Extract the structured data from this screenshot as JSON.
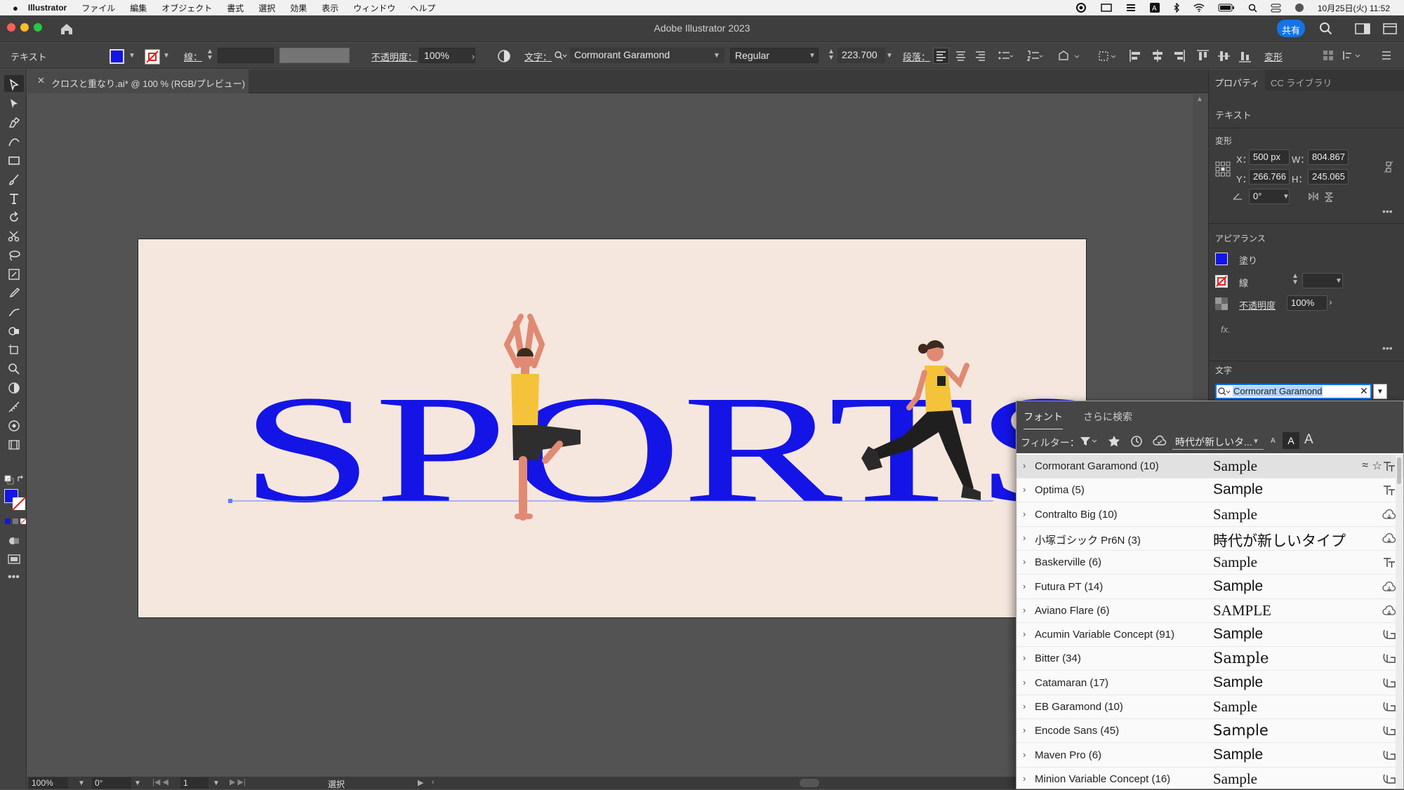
{
  "menubar": {
    "app": "Illustrator",
    "items": [
      "ファイル",
      "編集",
      "オブジェクト",
      "書式",
      "選択",
      "効果",
      "表示",
      "ウィンドウ",
      "ヘルプ"
    ],
    "datetime": "10月25日(火) 11:52"
  },
  "titlebar": {
    "title": "Adobe Illustrator 2023",
    "share_label": "共有"
  },
  "control": {
    "mode": "テキスト",
    "stroke_label": "線：",
    "opacity_label": "不透明度：",
    "opacity_value": "100%",
    "char_label": "文字：",
    "font_value": "Cormorant Garamond",
    "style_value": "Regular",
    "size_value": "223.700",
    "para_label": "段落：",
    "transform_label": "変形"
  },
  "doc": {
    "tab_title": "クロスと重なり.ai* @ 100 % (RGB/プレビュー)"
  },
  "artwork": {
    "text": "SPORTS",
    "text_color": "#1414e6",
    "bg_color": "#f5e7de"
  },
  "status": {
    "zoom": "100%",
    "rotation": "0°",
    "artboard_num": "1",
    "tool": "選択"
  },
  "properties": {
    "tab_properties": "プロパティ",
    "tab_cc": "CC ライブラリ",
    "type_heading": "テキスト",
    "transform_heading": "変形",
    "x_label": "X：",
    "x_value": "500 px",
    "y_label": "Y：",
    "y_value": "266.766",
    "w_label": "W：",
    "w_value": "804.867",
    "h_label": "H：",
    "h_value": "245.065",
    "angle_value": "0°",
    "appearance_heading": "アピアランス",
    "fill_label": "塗り",
    "stroke_label": "線",
    "opacity_label": "不透明度",
    "opacity_value": "100%",
    "fx_label": "fx.",
    "char_heading": "文字",
    "font_search_value": "Cormorant Garamond"
  },
  "font_popup": {
    "tab_fonts": "フォント",
    "tab_more": "さらに検索",
    "filter_label": "フィルター：",
    "sample_text_select": "時代が新しいタ...",
    "fonts": [
      {
        "name": "Cormorant Garamond (10)",
        "sample": "Sample",
        "icon": "tt-icon",
        "selected": true
      },
      {
        "name": "Optima (5)",
        "sample": "Sample",
        "icon": "tt-icon"
      },
      {
        "name": "Contralto Big (10)",
        "sample": "Sample",
        "icon": "cloud-activate-icon"
      },
      {
        "name": "小塚ゴシック Pr6N (3)",
        "sample": "時代が新しいタイプ",
        "icon": "cloud-activate-icon"
      },
      {
        "name": "Baskerville (6)",
        "sample": "Sample",
        "icon": "tt-icon"
      },
      {
        "name": "Futura PT (14)",
        "sample": "Sample",
        "icon": "cloud-activate-icon"
      },
      {
        "name": "Aviano Flare (6)",
        "sample": "SAMPLE",
        "icon": "cloud-activate-icon"
      },
      {
        "name": "Acumin Variable Concept (91)",
        "sample": "Sample",
        "icon": "variable-font-icon"
      },
      {
        "name": "Bitter (34)",
        "sample": "Sample",
        "icon": "variable-font-icon"
      },
      {
        "name": "Catamaran (17)",
        "sample": "Sample",
        "icon": "variable-font-icon"
      },
      {
        "name": "EB Garamond (10)",
        "sample": "Sample",
        "icon": "variable-font-icon"
      },
      {
        "name": "Encode Sans (45)",
        "sample": "Sample",
        "icon": "variable-font-icon"
      },
      {
        "name": "Maven Pro (6)",
        "sample": "Sample",
        "icon": "variable-font-icon"
      },
      {
        "name": "Minion Variable Concept (16)",
        "sample": "Sample",
        "icon": "variable-font-icon"
      }
    ]
  },
  "colors": {
    "fill": "#1414e6",
    "accent": "#1473e6"
  }
}
